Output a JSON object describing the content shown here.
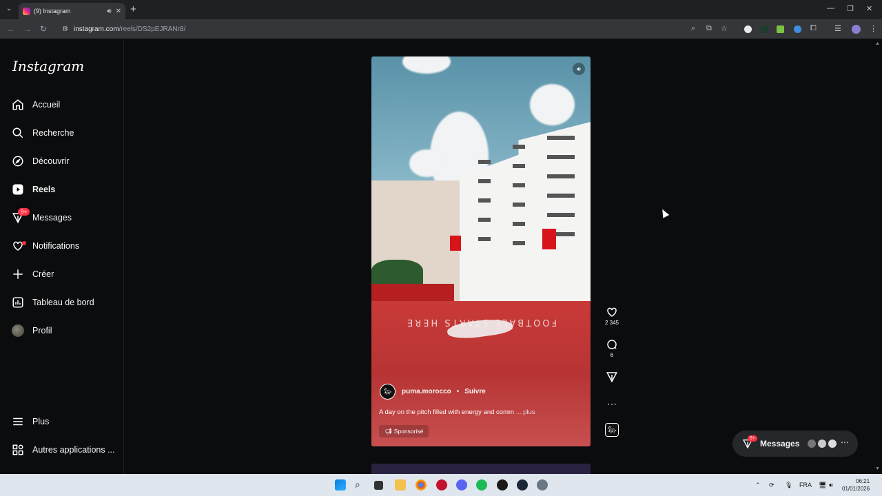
{
  "browser": {
    "tab_title": "(9) Instagram",
    "url_host": "instagram.com",
    "url_path": "/reels/DS2pEJRANr8/"
  },
  "sidebar": {
    "logo": "Instagram",
    "items": [
      {
        "label": "Accueil",
        "icon": "home-icon"
      },
      {
        "label": "Recherche",
        "icon": "search-icon"
      },
      {
        "label": "Découvrir",
        "icon": "compass-icon"
      },
      {
        "label": "Reels",
        "icon": "reels-icon"
      },
      {
        "label": "Messages",
        "icon": "messenger-icon",
        "badge": "9+"
      },
      {
        "label": "Notifications",
        "icon": "heart-icon"
      },
      {
        "label": "Créer",
        "icon": "plus-icon"
      },
      {
        "label": "Tableau de bord",
        "icon": "chart-icon"
      },
      {
        "label": "Profil",
        "icon": "profile-avatar"
      }
    ],
    "bottom_items": [
      {
        "label": "Plus",
        "icon": "menu-icon"
      },
      {
        "label": "Autres applications ...",
        "icon": "apps-icon"
      }
    ]
  },
  "reel": {
    "account": "puma.morocco",
    "separator": "•",
    "follow_label": "Suivre",
    "caption": "A day on the pitch filled with energy and comm",
    "caption_more": "... plus",
    "sponsored_label": "Sponsorisé",
    "ground_text": "FOOTBALL STARTS HERE",
    "likes": "2 345",
    "comments": "6"
  },
  "messages_pill": {
    "label": "Messages",
    "badge": "9+"
  },
  "taskbar": {
    "lang": "FRA",
    "time": "06:21",
    "date": "01/01/2026"
  },
  "colors": {
    "background": "#0b0c0e",
    "notification_red": "#ff3040",
    "pill_bg": "#25272a"
  }
}
